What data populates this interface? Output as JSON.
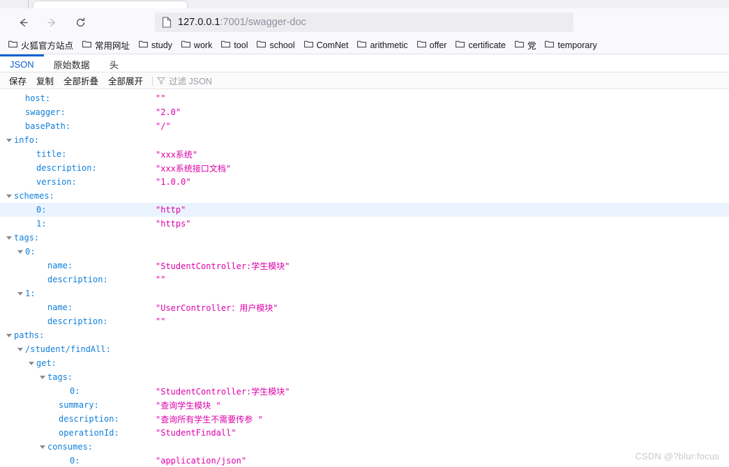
{
  "browser": {
    "nav": {
      "back_label": "Back",
      "forward_label": "Forward",
      "reload_label": "Reload"
    },
    "url": {
      "host": "127.0.0.1",
      "rest": ":7001/swagger-doc",
      "page_icon": "document-icon"
    },
    "bookmarks": [
      {
        "label": "火狐官方站点"
      },
      {
        "label": "常用网址"
      },
      {
        "label": "study"
      },
      {
        "label": "work"
      },
      {
        "label": "tool"
      },
      {
        "label": "school"
      },
      {
        "label": "ComNet"
      },
      {
        "label": "arithmetic"
      },
      {
        "label": "offer"
      },
      {
        "label": "certificate"
      },
      {
        "label": "党"
      },
      {
        "label": "temporary"
      }
    ]
  },
  "viewer": {
    "tabs": [
      {
        "label": "JSON",
        "active": true
      },
      {
        "label": "原始数据",
        "active": false
      },
      {
        "label": "头",
        "active": false
      }
    ],
    "toolbar": {
      "save": "保存",
      "copy": "复制",
      "collapse_all": "全部折叠",
      "expand_all": "全部展开",
      "filter_placeholder": "过滤 JSON",
      "filter_icon": "funnel-icon"
    },
    "rows": [
      {
        "indent": 1,
        "key": "host:",
        "value": "\"\"",
        "twisty": false,
        "hl": false
      },
      {
        "indent": 1,
        "key": "swagger:",
        "value": "\"2.0\"",
        "twisty": false,
        "hl": false
      },
      {
        "indent": 1,
        "key": "basePath:",
        "value": "\"/\"",
        "twisty": false,
        "hl": false
      },
      {
        "indent": 0,
        "key": "info:",
        "value": "",
        "twisty": true,
        "hl": false
      },
      {
        "indent": 2,
        "key": "title:",
        "value": "\"xxx系统\"",
        "twisty": false,
        "hl": false
      },
      {
        "indent": 2,
        "key": "description:",
        "value": "\"xxx系统接口文档\"",
        "twisty": false,
        "hl": false
      },
      {
        "indent": 2,
        "key": "version:",
        "value": "\"1.0.0\"",
        "twisty": false,
        "hl": false
      },
      {
        "indent": 0,
        "key": "schemes:",
        "value": "",
        "twisty": true,
        "hl": false
      },
      {
        "indent": 2,
        "key": "0:",
        "value": "\"http\"",
        "twisty": false,
        "hl": true
      },
      {
        "indent": 2,
        "key": "1:",
        "value": "\"https\"",
        "twisty": false,
        "hl": false
      },
      {
        "indent": 0,
        "key": "tags:",
        "value": "",
        "twisty": true,
        "hl": false
      },
      {
        "indent": 1,
        "key": "0:",
        "value": "",
        "twisty": true,
        "hl": false
      },
      {
        "indent": 3,
        "key": "name:",
        "value": "\"StudentController:学生模块\"",
        "twisty": false,
        "hl": false
      },
      {
        "indent": 3,
        "key": "description:",
        "value": "\"\"",
        "twisty": false,
        "hl": false
      },
      {
        "indent": 1,
        "key": "1:",
        "value": "",
        "twisty": true,
        "hl": false
      },
      {
        "indent": 3,
        "key": "name:",
        "value": "\"UserController：用户模块\"",
        "twisty": false,
        "hl": false
      },
      {
        "indent": 3,
        "key": "description:",
        "value": "\"\"",
        "twisty": false,
        "hl": false
      },
      {
        "indent": 0,
        "key": "paths:",
        "value": "",
        "twisty": true,
        "hl": false
      },
      {
        "indent": 1,
        "key": "/student/findAll:",
        "value": "",
        "twisty": true,
        "hl": false
      },
      {
        "indent": 2,
        "key": "get:",
        "value": "",
        "twisty": true,
        "hl": false
      },
      {
        "indent": 3,
        "key": "tags:",
        "value": "",
        "twisty": true,
        "hl": false
      },
      {
        "indent": 5,
        "key": "0:",
        "value": "\"StudentController:学生模块\"",
        "twisty": false,
        "hl": false
      },
      {
        "indent": 4,
        "key": "summary:",
        "value": "\"查询学生模块 \"",
        "twisty": false,
        "hl": false
      },
      {
        "indent": 4,
        "key": "description:",
        "value": "\"查询所有学生不需要传参 \"",
        "twisty": false,
        "hl": false
      },
      {
        "indent": 4,
        "key": "operationId:",
        "value": "\"StudentFindall\"",
        "twisty": false,
        "hl": false
      },
      {
        "indent": 3,
        "key": "consumes:",
        "value": "",
        "twisty": true,
        "hl": false
      },
      {
        "indent": 5,
        "key": "0:",
        "value": "\"application/json\"",
        "twisty": false,
        "hl": false
      }
    ]
  },
  "watermark": "CSDN @?blur:focus",
  "colors": {
    "accent": "#0a61d0",
    "json_key": "#0f7fdb",
    "json_value": "#dd00a9",
    "row_highlight": "#eaf3fe",
    "chrome_bg": "#f9f9fb"
  }
}
